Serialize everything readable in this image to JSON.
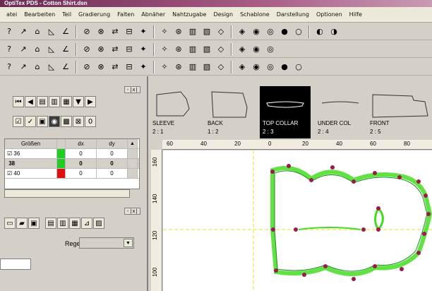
{
  "window": {
    "title": "OptiTex PDS - Cotton Shirt.dsn"
  },
  "menu": [
    "atei",
    "Bearbeiten",
    "Teil",
    "Gradierung",
    "Falten",
    "Abnäher",
    "Nahtzugabe",
    "Design",
    "Schablone",
    "Darstellung",
    "Optionen",
    "Hilfe"
  ],
  "toolbar1": [
    "cursor-arrow-icon",
    "new-file-icon",
    "open-folder-icon",
    "save-icon",
    "print-icon",
    "export-icon",
    "grid-icon",
    "zoom-tool-icon",
    "help-icon",
    "context-help-icon",
    "pen-icon",
    "measure-icon",
    "angle-icon",
    "split-icon",
    "join-icon",
    "mirror-icon",
    "fold-icon",
    "notch-icon",
    "drill-icon",
    "grade-icon",
    "table-icon",
    "image-icon"
  ],
  "toolbar2": [
    "point-icon",
    "curve-point-icon",
    "add-point-icon",
    "move-point-icon",
    "line-icon",
    "circle-icon",
    "rect-icon",
    "polyline-icon",
    "arc-icon",
    "ellipse-icon",
    "pattern-a-icon",
    "pattern-b-icon",
    "pattern-c-icon",
    "pattern-d-icon",
    "pattern-e-icon",
    "pattern-f-icon",
    "pattern-g-icon",
    "pattern-h-icon"
  ],
  "toolbar3": [
    "zoom-in-icon",
    "zoom-out-icon",
    "zoom-fit-icon",
    "zoom-area-icon",
    "undo-icon",
    "redo-icon",
    "delete-icon",
    "copy-icon",
    "paste-icon",
    "layer-a-icon",
    "layer-b-icon",
    "layer-c-icon",
    "layer-d-icon",
    "layer-e-icon",
    "seam-icon",
    "notch-b-icon",
    "button-icon",
    "fold-b-icon",
    "marker-icon",
    "marker-b-icon"
  ],
  "grading": {
    "columns": [
      "Größen",
      "dx",
      "dy"
    ],
    "rows": [
      {
        "name": "36",
        "checked": "☑",
        "color": "#22cc22",
        "dx": "0",
        "dy": "0"
      },
      {
        "name": "38",
        "checked": "",
        "color": "#22cc22",
        "dx": "0",
        "dy": "0"
      },
      {
        "name": "40",
        "checked": "☑",
        "color": "#dd1111",
        "dx": "0",
        "dy": "0"
      }
    ]
  },
  "panel": {
    "regel_label": "Regel"
  },
  "pieces": [
    {
      "name": "SLEEVE",
      "num": "2 : 1"
    },
    {
      "name": "BACK",
      "num": "1 : 2"
    },
    {
      "name": "TOP COLLAR",
      "num": "2 : 3"
    },
    {
      "name": "UNDER COL",
      "num": "2 : 4"
    },
    {
      "name": "FRONT",
      "num": "2 : 5"
    }
  ],
  "ruler_top": [
    "60",
    "40",
    "20",
    "0",
    "20",
    "40",
    "60",
    "80"
  ],
  "ruler_left": [
    "160",
    "140",
    "120",
    "100"
  ],
  "colors": {
    "grade_line": "#44dd22",
    "point": "#9a1a4a",
    "guide": "#e8e020",
    "title_bar": "#6a2a52"
  }
}
